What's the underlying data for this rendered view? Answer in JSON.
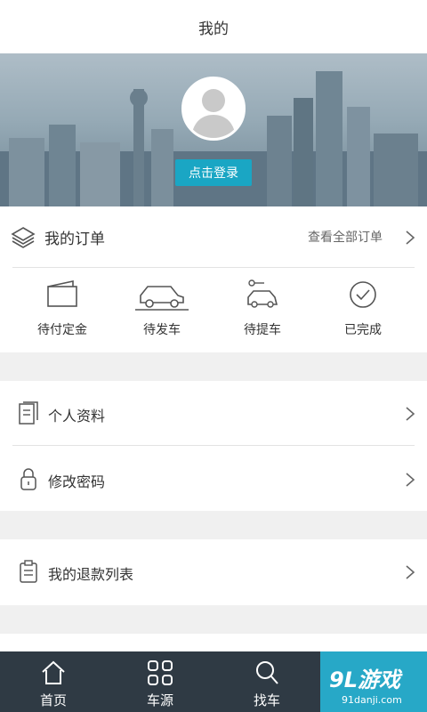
{
  "header": {
    "title": "我的"
  },
  "profile": {
    "login_label": "点击登录"
  },
  "orders": {
    "title": "我的订单",
    "view_all": "查看全部订单",
    "statuses": [
      {
        "label": "待付定金",
        "icon": "wallet-icon"
      },
      {
        "label": "待发车",
        "icon": "car-icon"
      },
      {
        "label": "待提车",
        "icon": "car-key-icon"
      },
      {
        "label": "已完成",
        "icon": "check-circle-icon"
      }
    ]
  },
  "menu": {
    "profile_info": "个人资料",
    "change_password": "修改密码",
    "refund_list": "我的退款列表"
  },
  "tabbar": {
    "items": [
      {
        "label": "首页",
        "icon": "home-icon"
      },
      {
        "label": "车源",
        "icon": "grid-icon"
      },
      {
        "label": "找车",
        "icon": "search-icon"
      }
    ]
  },
  "watermark": {
    "brand": "9L游戏",
    "url": "91danji.com"
  },
  "colors": {
    "accent": "#1aa6c4",
    "tabbar_bg": "#2f3a44",
    "page_bg": "#f0f0f0"
  }
}
